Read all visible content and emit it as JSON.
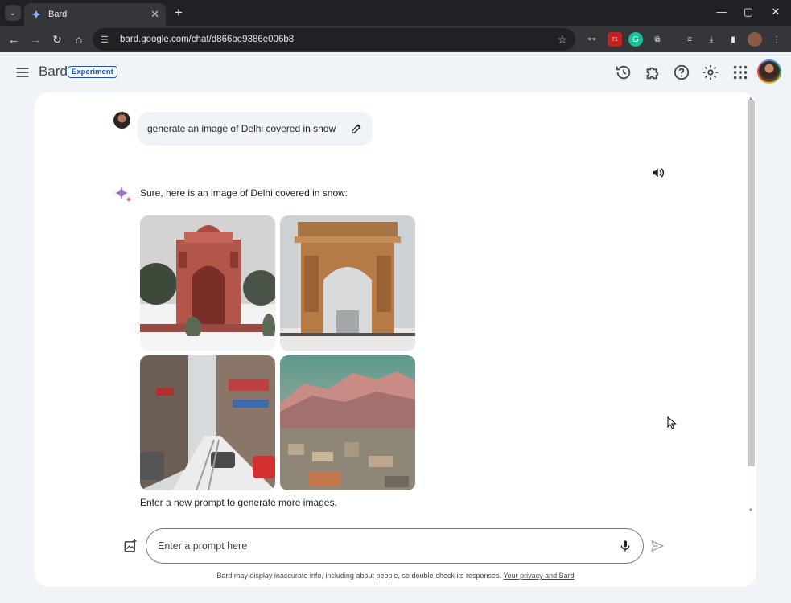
{
  "browser": {
    "tab_title": "Bard",
    "url": "bard.google.com/chat/d866be9386e006b8",
    "extension_badge": "71"
  },
  "app": {
    "brand": "Bard",
    "badge": "Experiment"
  },
  "chat": {
    "user_prompt": "generate an image of Delhi covered in snow",
    "reply_intro": "Sure, here is an image of Delhi covered in snow:",
    "reply_footer": "Enter a new prompt to generate more images."
  },
  "composer": {
    "placeholder": "Enter a prompt here"
  },
  "footer": {
    "disclaimer": "Bard may display inaccurate info, including about people, so double-check its responses.",
    "privacy_link": "Your privacy and Bard"
  },
  "colors": {
    "accent": "#0b57d0",
    "page_bg": "#f0f4f9",
    "chrome_dark": "#202124"
  }
}
